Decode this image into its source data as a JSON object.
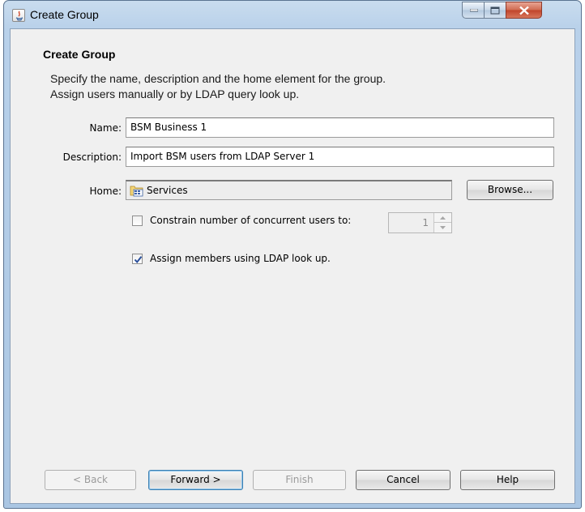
{
  "window": {
    "title": "Create Group"
  },
  "page": {
    "heading": "Create Group",
    "description_lines": [
      "Specify the name, description and the home element for the group.",
      "Assign users manually or by LDAP query look up."
    ]
  },
  "form": {
    "name_label": "Name:",
    "name_value": "BSM Business 1",
    "description_label": "Description:",
    "description_value": "Import BSM users from LDAP Server 1",
    "home_label": "Home:",
    "home_value": "Services",
    "browse_label": "Browse...",
    "constrain_label": "Constrain number of concurrent users to:",
    "constrain_checked": false,
    "concurrent_users_value": "1",
    "ldap_label": "Assign members using LDAP look up.",
    "ldap_checked": true
  },
  "buttons": {
    "back": "< Back",
    "forward": "Forward >",
    "finish": "Finish",
    "cancel": "Cancel",
    "help": "Help"
  },
  "colors": {
    "titlebar": "#b9d1ea",
    "client_bg": "#f0f0f0",
    "close_button": "#c0432a",
    "checkmark": "#2a4f9b"
  }
}
